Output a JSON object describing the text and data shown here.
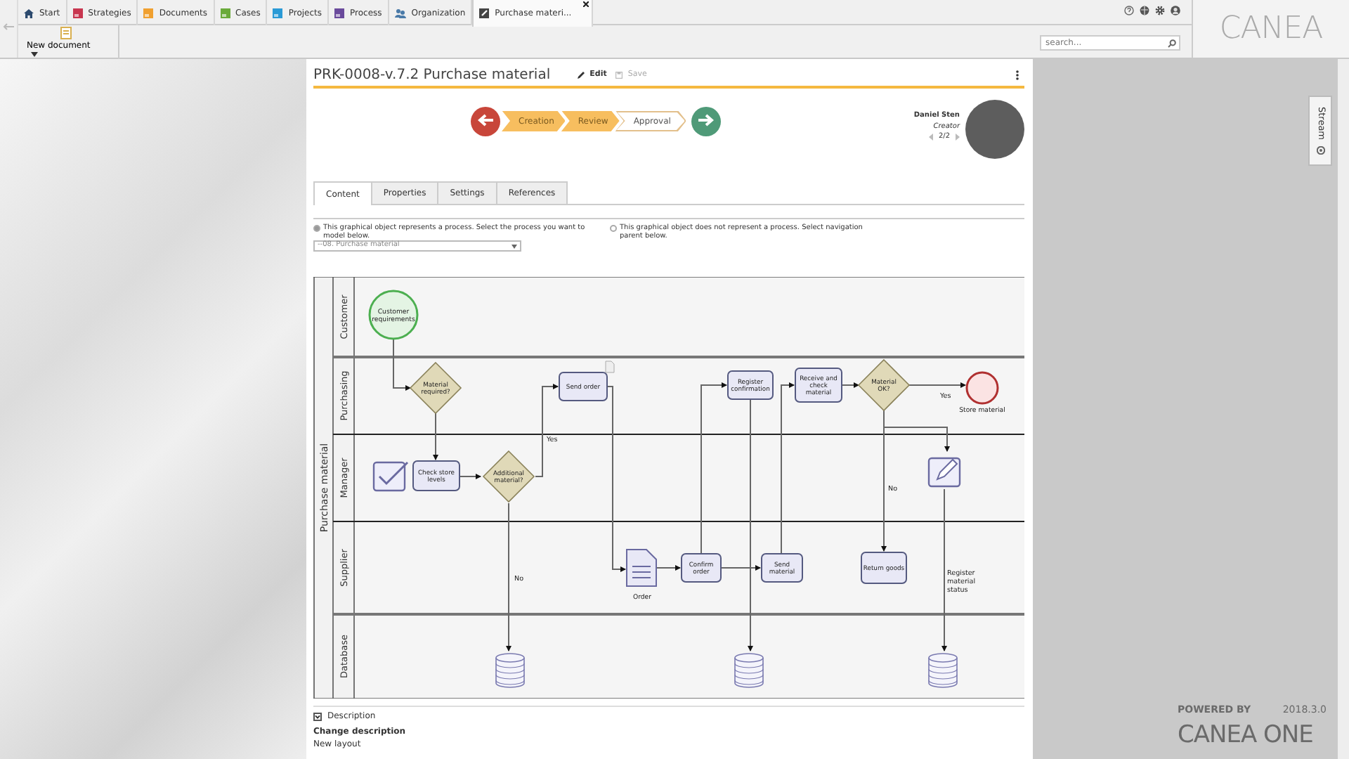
{
  "app_tabs": [
    {
      "label": "Start",
      "kind": "home",
      "color": "#2c4a6e",
      "selected": false
    },
    {
      "label": "Strategies",
      "kind": "square",
      "color": "#c8364f",
      "selected": false
    },
    {
      "label": "Documents",
      "kind": "square",
      "color": "#f0a030",
      "selected": false
    },
    {
      "label": "Cases",
      "kind": "square",
      "color": "#6aaa3a",
      "selected": false
    },
    {
      "label": "Projects",
      "kind": "square",
      "color": "#2a9ad6",
      "selected": false
    },
    {
      "label": "Process",
      "kind": "square",
      "color": "#6a4a9c",
      "selected": false
    },
    {
      "label": "Organization",
      "kind": "people",
      "color": "#4a7aa8",
      "selected": false
    },
    {
      "label": "Purchase materi...",
      "kind": "edit",
      "color": "#444444",
      "selected": true
    }
  ],
  "toolbar": {
    "new_document": "New document"
  },
  "search": {
    "placeholder": "search..."
  },
  "logo": "CANEA",
  "document": {
    "title": "PRK-0008-v.7.2 Purchase material",
    "edit": "Edit",
    "save": "Save",
    "save_disabled": true,
    "workflow": [
      {
        "label": "Creation",
        "done": true
      },
      {
        "label": "Review",
        "done": true
      },
      {
        "label": "Approval",
        "done": false
      }
    ],
    "person": {
      "name": "Daniel Sten",
      "role": "Creator",
      "pager": "2/2"
    },
    "tabs": [
      {
        "label": "Content",
        "selected": true
      },
      {
        "label": "Properties",
        "selected": false
      },
      {
        "label": "Settings",
        "selected": false
      },
      {
        "label": "References",
        "selected": false
      }
    ],
    "options": [
      {
        "label": "This graphical object represents a process. Select the process you want to model below.",
        "selected": true
      },
      {
        "label": "This graphical object does not represent a process. Select navigation parent below.",
        "selected": false
      }
    ],
    "process_select": "--08. Purchase material",
    "diagram": {
      "pool": "Purchase material",
      "lanes": [
        "Customer",
        "Purchasing",
        "Manager",
        "Supplier",
        "Database"
      ],
      "nodes": [
        {
          "kind": "start",
          "label": "Customer requirements"
        },
        {
          "kind": "gateway",
          "label": "Material required?"
        },
        {
          "kind": "check"
        },
        {
          "kind": "task",
          "label": "Check store levels"
        },
        {
          "kind": "gateway",
          "label": "Additional material?"
        },
        {
          "kind": "task",
          "label": "Send order"
        },
        {
          "kind": "document",
          "label": "Order"
        },
        {
          "kind": "task",
          "label": "Confirm order"
        },
        {
          "kind": "task",
          "label": "Send material"
        },
        {
          "kind": "task",
          "label": "Register confirmation"
        },
        {
          "kind": "task",
          "label": "Receive and check material"
        },
        {
          "kind": "gateway",
          "label": "Material OK?"
        },
        {
          "kind": "end",
          "label": "Store material"
        },
        {
          "kind": "task",
          "label": "Return goods"
        },
        {
          "kind": "edit"
        },
        {
          "kind": "database"
        },
        {
          "kind": "database"
        },
        {
          "kind": "database"
        }
      ],
      "flow_labels": [
        "Yes",
        "No",
        "Yes",
        "No",
        "Register material status"
      ]
    },
    "description": {
      "toggle": "Description",
      "change_title": "Change description",
      "change_text": "New layout"
    }
  },
  "stream": "Stream",
  "footer": {
    "powered_by": "POWERED BY",
    "version": "2018.3.0",
    "product": "CANEA ONE"
  }
}
